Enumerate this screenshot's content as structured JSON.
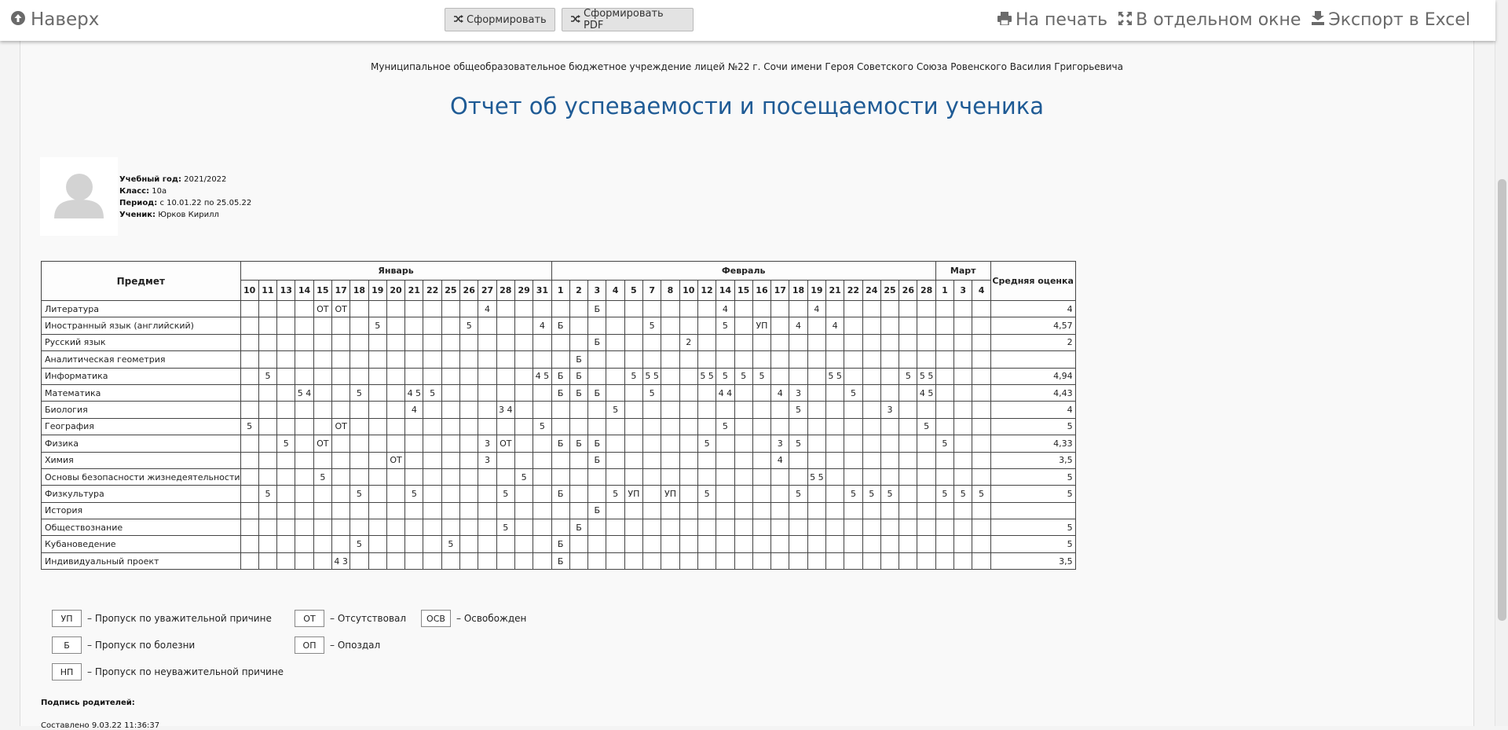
{
  "toolbar": {
    "top_label": "Наверх",
    "form_label": "Сформировать",
    "form_pdf_label": "Сформировать PDF",
    "print_label": "На печать",
    "window_label": "В отдельном окне",
    "excel_label": "Экспорт в Excel"
  },
  "report": {
    "org_name": "Муниципальное общеобразовательное бюджетное учреждение лицей №22 г. Сочи имени Героя Советского Союза Ровенского Василия Григорьевича",
    "title": "Отчет об успеваемости и посещаемости ученика",
    "info": {
      "year_label": "Учебный год:",
      "year_value": "2021/2022",
      "class_label": "Класс:",
      "class_value": "10а",
      "period_label": "Период:",
      "period_value": "с 10.01.22 по 25.05.22",
      "student_label": "Ученик:",
      "student_value": "Юрков Кирилл"
    }
  },
  "table": {
    "subject_header": "Предмет",
    "avg_header": "Средняя оценка",
    "months": [
      {
        "name": "Январь",
        "days": [
          "10",
          "11",
          "13",
          "14",
          "15",
          "17",
          "18",
          "19",
          "20",
          "21",
          "22",
          "25",
          "26",
          "27",
          "28",
          "29",
          "31"
        ]
      },
      {
        "name": "Февраль",
        "days": [
          "1",
          "2",
          "3",
          "4",
          "5",
          "7",
          "8",
          "10",
          "12",
          "14",
          "15",
          "16",
          "17",
          "18",
          "19",
          "21",
          "22",
          "24",
          "25",
          "26",
          "28"
        ]
      },
      {
        "name": "Март",
        "days": [
          "1",
          "3",
          "4"
        ]
      }
    ],
    "rows": [
      {
        "subject": "Литература",
        "avg": "4",
        "cells": {
          "4": "ОТ",
          "5": "ОТ",
          "13": "4",
          "19": "Б",
          "26": "4",
          "31": "4"
        }
      },
      {
        "subject": "Иностранный язык (английский)",
        "avg": "4,57",
        "cells": {
          "7": "5",
          "12": "5",
          "16": "4",
          "17": "Б",
          "22": "5",
          "26": "5",
          "28": "УП",
          "30": "4",
          "32": "4"
        }
      },
      {
        "subject": "Русский язык",
        "avg": "2",
        "cells": {
          "19": "Б",
          "24": "2"
        }
      },
      {
        "subject": "Аналитическая геометрия",
        "avg": "",
        "cells": {
          "18": "Б"
        }
      },
      {
        "subject": "Информатика",
        "avg": "4,94",
        "cells": {
          "1": "5",
          "16": "4 5",
          "17": "Б",
          "18": "Б",
          "21": "5",
          "22": "5 5",
          "25": "5 5",
          "26": "5",
          "27": "5",
          "28": "5",
          "32": "5 5",
          "36": "5",
          "37": "5 5"
        }
      },
      {
        "subject": "Математика",
        "avg": "4,43",
        "cells": {
          "3": "5 4",
          "6": "5",
          "9": "4 5",
          "10": "5",
          "17": "Б",
          "18": "Б",
          "19": "Б",
          "22": "5",
          "26": "4 4",
          "29": "4",
          "30": "3",
          "33": "5",
          "37": "4 5"
        }
      },
      {
        "subject": "Биология",
        "avg": "4",
        "cells": {
          "9": "4",
          "14": "3 4",
          "20": "5",
          "30": "5",
          "35": "3"
        }
      },
      {
        "subject": "География",
        "avg": "5",
        "cells": {
          "0": "5",
          "5": "ОТ",
          "16": "5",
          "26": "5",
          "37": "5"
        }
      },
      {
        "subject": "Физика",
        "avg": "4,33",
        "cells": {
          "2": "5",
          "4": "ОТ",
          "13": "3",
          "14": "ОТ",
          "17": "Б",
          "18": "Б",
          "19": "Б",
          "25": "5",
          "29": "3",
          "30": "5",
          "38": "5"
        }
      },
      {
        "subject": "Химия",
        "avg": "3,5",
        "cells": {
          "8": "ОТ",
          "13": "3",
          "19": "Б",
          "29": "4"
        }
      },
      {
        "subject": "Основы безопасности жизнедеятельности",
        "avg": "5",
        "cells": {
          "4": "5",
          "15": "5",
          "31": "5 5"
        }
      },
      {
        "subject": "Физкультура",
        "avg": "5",
        "cells": {
          "1": "5",
          "6": "5",
          "9": "5",
          "14": "5",
          "17": "Б",
          "20": "5",
          "21": "УП",
          "23": "УП",
          "25": "5",
          "30": "5",
          "33": "5",
          "34": "5",
          "35": "5",
          "38": "5",
          "39": "5",
          "40": "5"
        }
      },
      {
        "subject": "История",
        "avg": "",
        "cells": {
          "19": "Б"
        }
      },
      {
        "subject": "Обществознание",
        "avg": "5",
        "cells": {
          "14": "5",
          "18": "Б"
        }
      },
      {
        "subject": "Кубановедение",
        "avg": "5",
        "cells": {
          "6": "5",
          "11": "5",
          "17": "Б"
        }
      },
      {
        "subject": "Индивидуальный проект",
        "avg": "3,5",
        "cells": {
          "5": "4 3",
          "17": "Б"
        }
      }
    ]
  },
  "legend": [
    {
      "code": "УП",
      "text": "– Пропуск по уважительной причине"
    },
    {
      "code": "ОТ",
      "text": "– Отсутствовал"
    },
    {
      "code": "ОСВ",
      "text": "– Освобожден"
    },
    {
      "code": "Б",
      "text": "– Пропуск по болезни"
    },
    {
      "code": "ОП",
      "text": "– Опоздал"
    },
    {
      "code": "НП",
      "text": "– Пропуск по неуважительной причине"
    }
  ],
  "footer": {
    "sign_label": "Подпись родителей:",
    "created_label": "Составлено 9.03.22 11:36:37"
  }
}
